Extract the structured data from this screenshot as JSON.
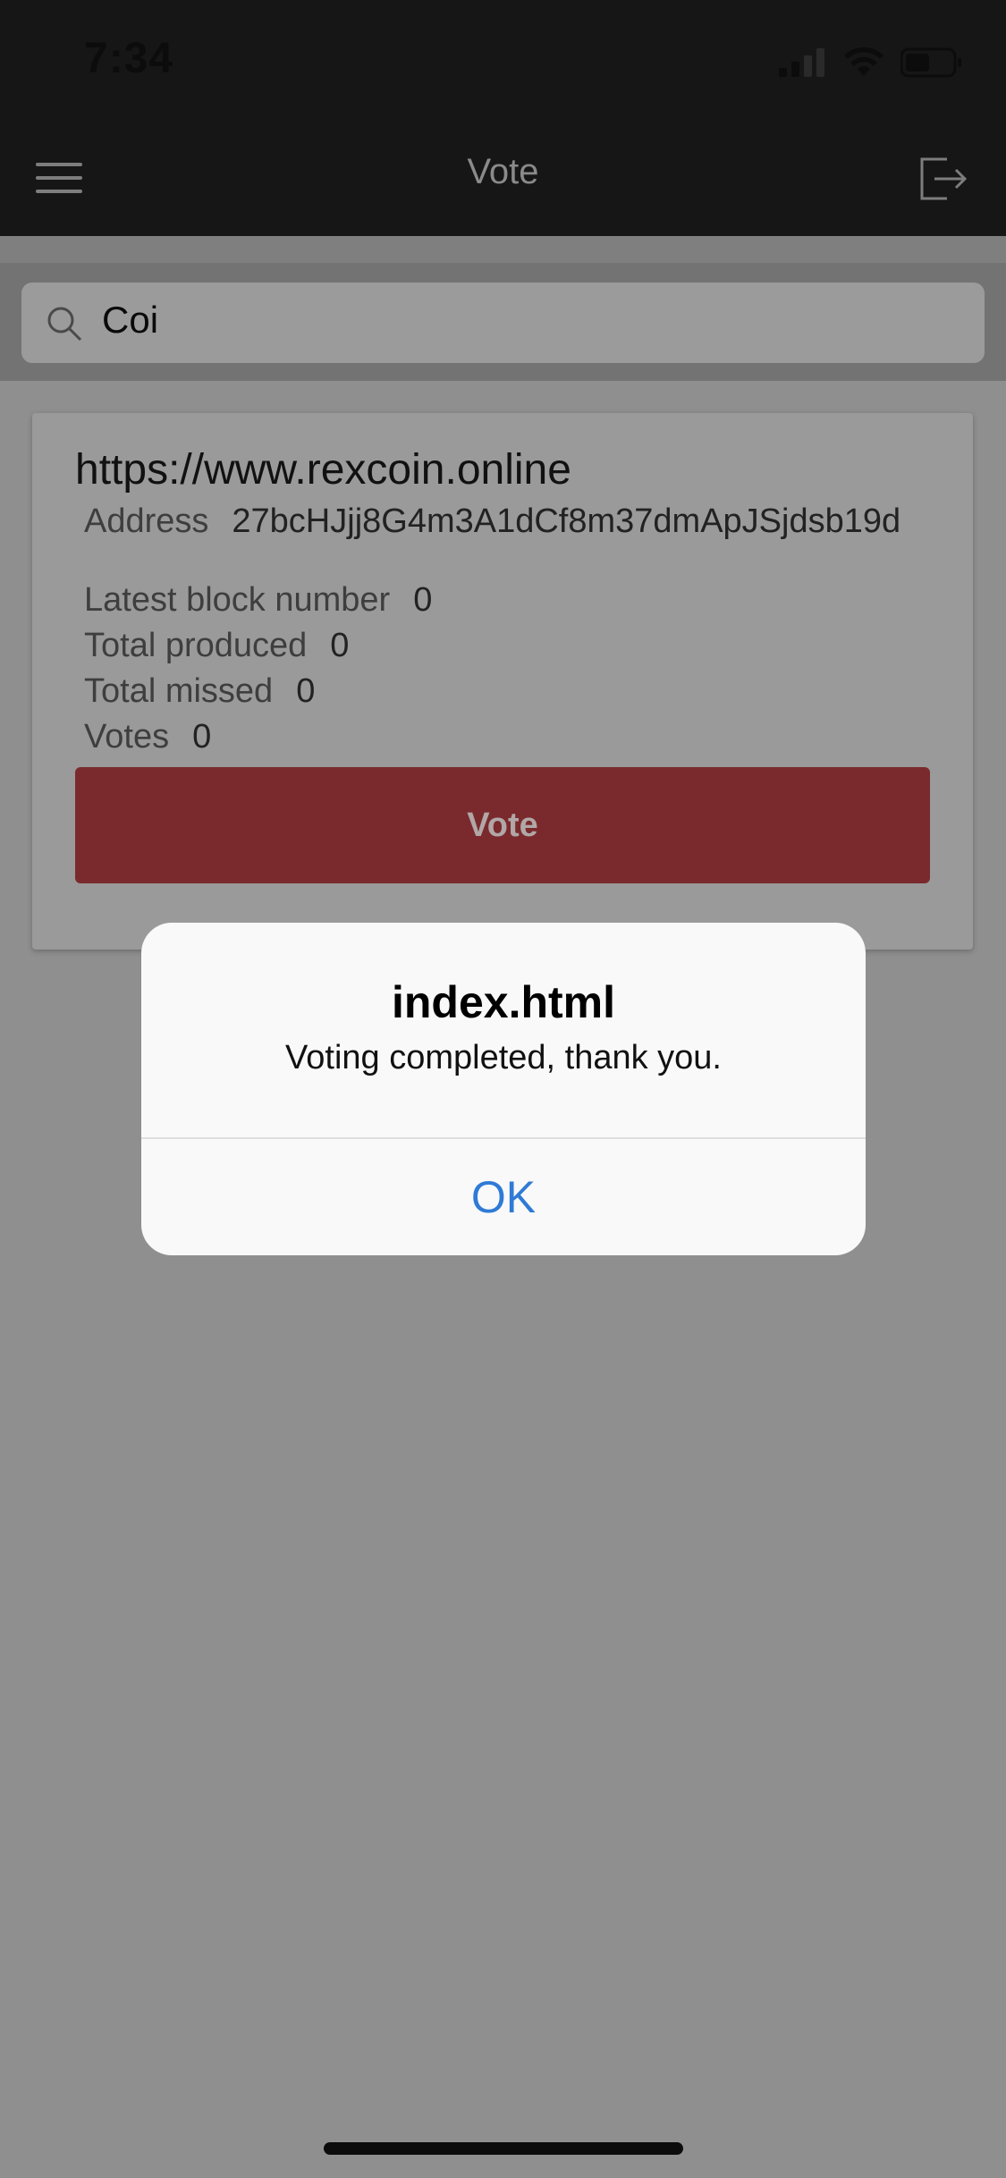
{
  "status_bar": {
    "time": "7:34"
  },
  "nav": {
    "title": "Vote",
    "left_icon": "hamburger-menu-icon",
    "right_icon": "logout-icon"
  },
  "search": {
    "value": "Coi",
    "icon": "search-icon"
  },
  "candidate": {
    "url": "https://www.rexcoin.online",
    "address_label": "Address",
    "address_value": "27bcHJjj8G4m3A1dCf8m37dmApJSjdsb19d",
    "latest_block_label": "Latest block number",
    "latest_block_value": "0",
    "total_produced_label": "Total produced",
    "total_produced_value": "0",
    "total_missed_label": "Total missed",
    "total_missed_value": "0",
    "votes_label": "Votes",
    "votes_value": "0",
    "vote_button_label": "Vote"
  },
  "alert": {
    "title": "index.html",
    "message": "Voting completed, thank you.",
    "ok_label": "OK"
  },
  "colors": {
    "vote_button": "#7a2a2d",
    "alert_action": "#2f7ad6",
    "overlay_background": "#8e8f8e"
  }
}
